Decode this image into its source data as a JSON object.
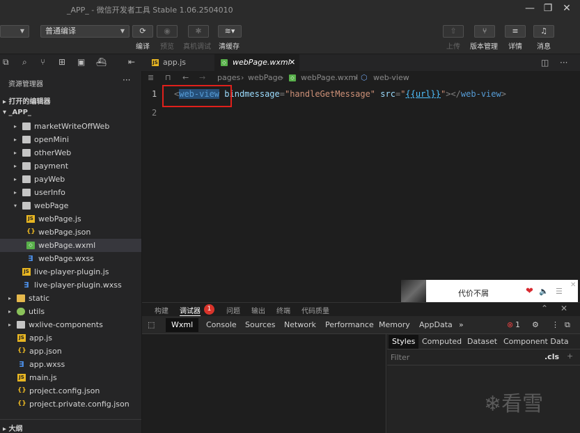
{
  "window": {
    "title": "_APP_ - 微信开发者工具 Stable 1.06.2504010"
  },
  "toolbar": {
    "compile_mode": "普通编译",
    "compile_label": "编译",
    "preview_label": "预览",
    "remote_debug_label": "真机调试",
    "clear_cache_label": "清缓存",
    "upload_label": "上传",
    "version_label": "版本管理",
    "details_label": "详情",
    "messages_label": "消息"
  },
  "sidebar": {
    "title": "资源管理器",
    "more": "···",
    "open_editors": "打开的编辑器",
    "project": "_APP_",
    "outline": "大纲",
    "tree": [
      {
        "name": "marketWriteOffWeb",
        "type": "folder"
      },
      {
        "name": "openMini",
        "type": "folder"
      },
      {
        "name": "otherWeb",
        "type": "folder"
      },
      {
        "name": "payment",
        "type": "folder"
      },
      {
        "name": "payWeb",
        "type": "folder"
      },
      {
        "name": "userInfo",
        "type": "folder"
      },
      {
        "name": "webPage",
        "type": "folder-open"
      },
      {
        "name": "webPage.js",
        "type": "js"
      },
      {
        "name": "webPage.json",
        "type": "json"
      },
      {
        "name": "webPage.wxml",
        "type": "wxml"
      },
      {
        "name": "webPage.wxss",
        "type": "wxss"
      },
      {
        "name": "live-player-plugin.js",
        "type": "js"
      },
      {
        "name": "live-player-plugin.wxss",
        "type": "wxss"
      },
      {
        "name": "static",
        "type": "folder-yellow"
      },
      {
        "name": "utils",
        "type": "folder-green"
      },
      {
        "name": "wxlive-components",
        "type": "folder"
      },
      {
        "name": "app.js",
        "type": "js"
      },
      {
        "name": "app.json",
        "type": "json"
      },
      {
        "name": "app.wxss",
        "type": "wxss"
      },
      {
        "name": "main.js",
        "type": "js"
      },
      {
        "name": "project.config.json",
        "type": "json"
      },
      {
        "name": "project.private.config.json",
        "type": "json"
      }
    ]
  },
  "editor": {
    "tabs": [
      "app.js",
      "webPage.wxml"
    ],
    "breadcrumb": [
      "pages",
      "webPage",
      "webPage.wxml",
      "web-view"
    ],
    "line_numbers": [
      "1",
      "2"
    ],
    "code": {
      "open_bracket": "<",
      "tag": "web-view",
      "attr1": "bindmessage",
      "eq": "=",
      "val1": "\"handleGetMessage\"",
      "attr2": "src",
      "q": "\"",
      "tmpl": "{{url}}",
      "close": "></",
      "tag_end": "web-view",
      "gt": ">"
    }
  },
  "popup": {
    "title": "代价不屑"
  },
  "panel": {
    "tabs": [
      "构建",
      "调试器",
      "问题",
      "输出",
      "终端",
      "代码质量"
    ],
    "debugger_badge": "1",
    "devtools_tabs": [
      "Wxml",
      "Console",
      "Sources",
      "Network",
      "Performance",
      "Memory",
      "AppData",
      "»"
    ],
    "error_count": "1",
    "styles_tabs": [
      "Styles",
      "Computed",
      "Dataset",
      "Component Data"
    ],
    "filter_placeholder": "Filter",
    "cls_label": ".cls",
    "plus": "+"
  },
  "watermark": "看雪"
}
